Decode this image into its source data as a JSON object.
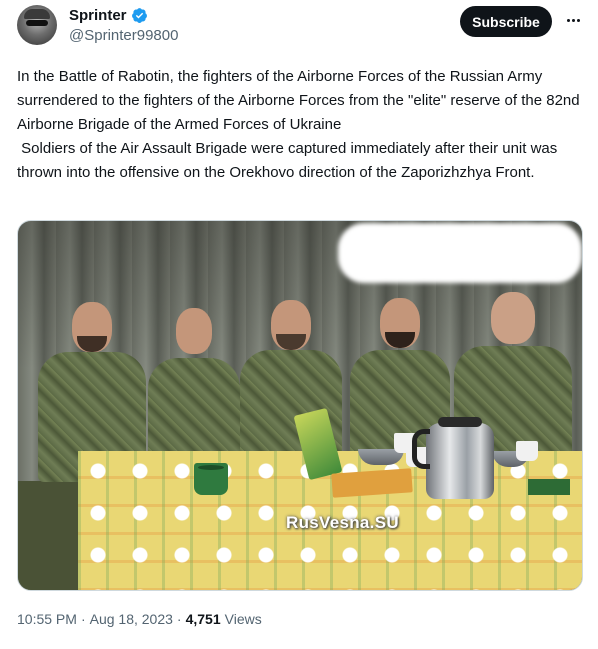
{
  "author": {
    "display_name": "Sprinter",
    "handle": "@Sprinter99800",
    "verified_icon": "verified-badge-icon",
    "accent_color": "#1d9bf0"
  },
  "actions": {
    "subscribe_label": "Subscribe",
    "more_icon": "more-horizontal-icon"
  },
  "tweet": {
    "text": "In the Battle of Rabotin, the fighters of the Airborne Forces of the Russian Army surrendered to the fighters of the Airborne Forces from the \"elite\" reserve of the 82nd Airborne Brigade of the Armed Forces of Ukraine\n Soldiers of the Air Assault Brigade were captured immediately after their unit was thrown into the offensive on the Orekhovo direction of the Zaporizhzhya Front."
  },
  "media": {
    "watermark": "RusVesna.SU"
  },
  "meta": {
    "time": "10:55 PM",
    "separator": "·",
    "date": "Aug 18, 2023",
    "views_count": "4,751",
    "views_label": "Views"
  }
}
